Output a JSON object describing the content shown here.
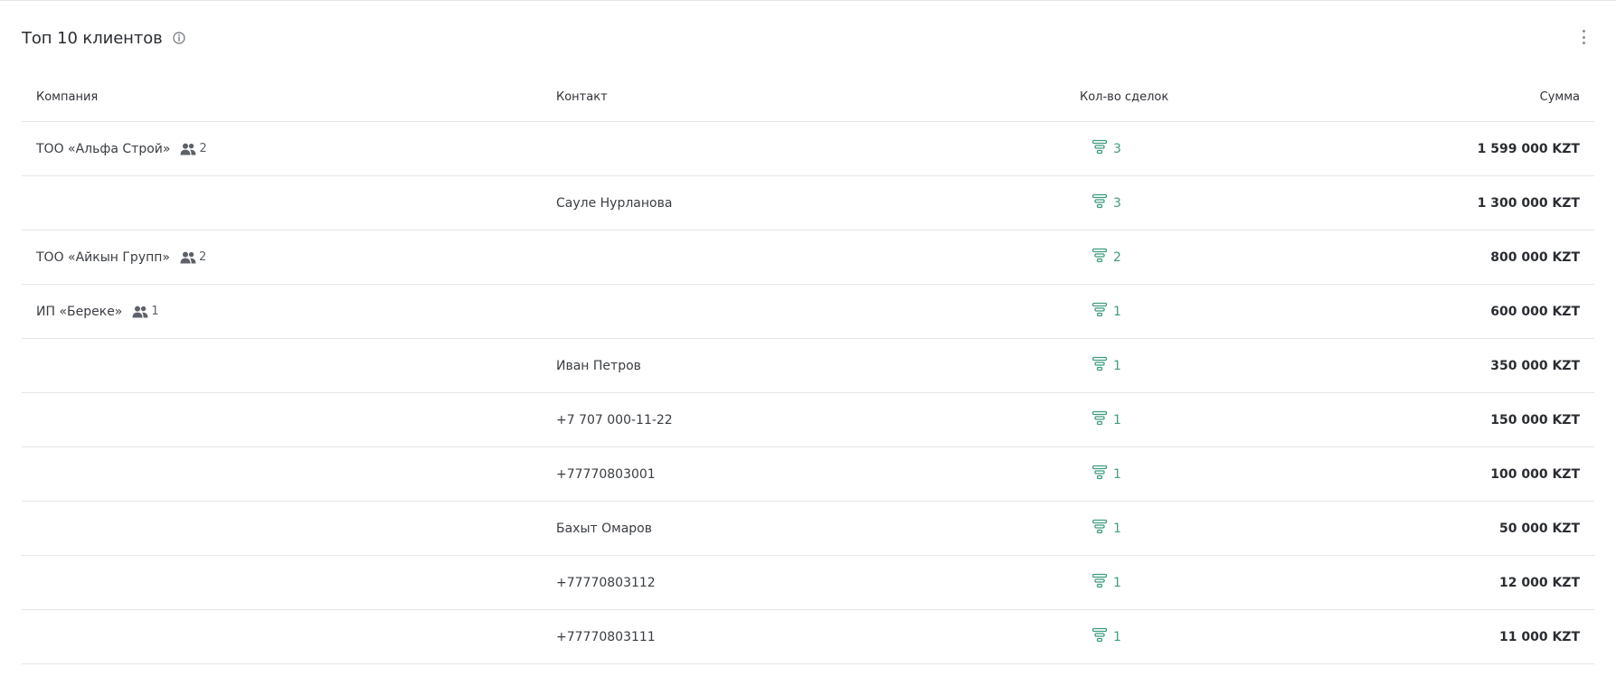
{
  "widget": {
    "title": "Топ 10 клиентов",
    "icons": {
      "info": "info-circle-icon",
      "menu": "more-vertical-icon"
    }
  },
  "table": {
    "columns": {
      "company": "Компания",
      "contact": "Контакт",
      "deals": "Кол-во сделок",
      "sum": "Сумма"
    },
    "rows": [
      {
        "company": "ТОО «Альфа Строй»",
        "members": "2",
        "contact": "",
        "deals": "3",
        "sum": "1 599 000 KZT"
      },
      {
        "company": "",
        "members": "",
        "contact": "Сауле Нурланова",
        "deals": "3",
        "sum": "1 300 000 KZT"
      },
      {
        "company": "ТОО «Айкын Групп»",
        "members": "2",
        "contact": "",
        "deals": "2",
        "sum": "800 000 KZT"
      },
      {
        "company": "ИП «Береке»",
        "members": "1",
        "contact": "",
        "deals": "1",
        "sum": "600 000 KZT"
      },
      {
        "company": "",
        "members": "",
        "contact": "Иван Петров",
        "deals": "1",
        "sum": "350 000 KZT"
      },
      {
        "company": "",
        "members": "",
        "contact": "+7 707 000-11-22",
        "deals": "1",
        "sum": "150 000 KZT"
      },
      {
        "company": "",
        "members": "",
        "contact": "+77770803001",
        "deals": "1",
        "sum": "100 000 KZT"
      },
      {
        "company": "",
        "members": "",
        "contact": "Бахыт Омаров",
        "deals": "1",
        "sum": "50 000 KZT"
      },
      {
        "company": "",
        "members": "",
        "contact": "+77770803112",
        "deals": "1",
        "sum": "12 000 KZT"
      },
      {
        "company": "",
        "members": "",
        "contact": "+77770803111",
        "deals": "1",
        "sum": "11 000 KZT"
      }
    ]
  },
  "colors": {
    "accent_green": "#3f9c81",
    "text": "#2f3237",
    "divider": "#e3e5e8"
  }
}
